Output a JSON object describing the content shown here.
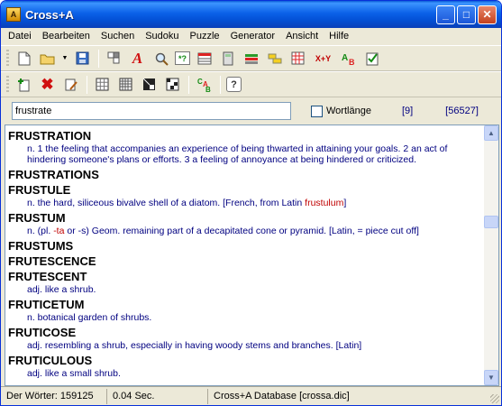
{
  "window": {
    "title": "Cross+A"
  },
  "menu": [
    {
      "label": "Datei",
      "name": "menu-datei"
    },
    {
      "label": "Bearbeiten",
      "name": "menu-bearbeiten"
    },
    {
      "label": "Suchen",
      "name": "menu-suchen"
    },
    {
      "label": "Sudoku",
      "name": "menu-sudoku"
    },
    {
      "label": "Puzzle",
      "name": "menu-puzzle"
    },
    {
      "label": "Generator",
      "name": "menu-generator"
    },
    {
      "label": "Ansicht",
      "name": "menu-ansicht"
    },
    {
      "label": "Hilfe",
      "name": "menu-hilfe"
    }
  ],
  "toolbar1": {
    "xy_label": "X+Y",
    "icons": [
      "new-file-icon",
      "open-folder-icon",
      "save-icon",
      "crossword-grid-icon",
      "font-icon",
      "find-icon",
      "replace-icon",
      "table-icon",
      "calculator-icon",
      "word-list-icon",
      "highlight-icon",
      "grid-pattern-icon",
      "xy-icon",
      "letters-ab-icon",
      "check-list-icon"
    ]
  },
  "toolbar2": {
    "icons": [
      "add-icon",
      "delete-icon",
      "edit-icon",
      "sudoku-icon",
      "sudoku-variant-icon",
      "kakuro-icon",
      "checker-grid-icon",
      "letters-cab-icon",
      "help-icon"
    ],
    "help_label": "?"
  },
  "search": {
    "value": "frustrate",
    "checkbox_label": "Wortlänge",
    "count_found": "[9]",
    "count_total": "[56527]"
  },
  "entries": [
    {
      "word": "FRUSTRATION",
      "def": "n. 1 the feeling that accompanies an experience of being thwarted in attaining your goals. 2 an act of hindering someone's plans or efforts. 3 a feeling of annoyance at being hindered or criticized."
    },
    {
      "word": "FRUSTRATIONS",
      "def": ""
    },
    {
      "word": "FRUSTULE",
      "def": "n. the hard, siliceous bivalve shell of a diatom. [French, from Latin ",
      "def_red": "frustulum",
      "def_tail": "]"
    },
    {
      "word": "FRUSTUM",
      "def": "n. (pl. ",
      "def_red": "-ta",
      "def_tail": " or -s) Geom. remaining part of a decapitated cone or pyramid. [Latin, = piece cut off]"
    },
    {
      "word": "FRUSTUMS",
      "def": ""
    },
    {
      "word": "FRUTESCENCE",
      "def": ""
    },
    {
      "word": "FRUTESCENT",
      "def": "adj. like a shrub."
    },
    {
      "word": "FRUTICETUM",
      "def": "n. botanical garden of shrubs."
    },
    {
      "word": "FRUTICOSE",
      "def": "adj. resembling a shrub, especially in having woody stems and branches. [Latin]"
    },
    {
      "word": "FRUTICULOUS",
      "def": "adj. like a small shrub."
    }
  ],
  "status": {
    "word_count": "Der Wörter: 159125",
    "time": "0.04 Sec.",
    "database": "Cross+A Database [crossa.dic]"
  }
}
